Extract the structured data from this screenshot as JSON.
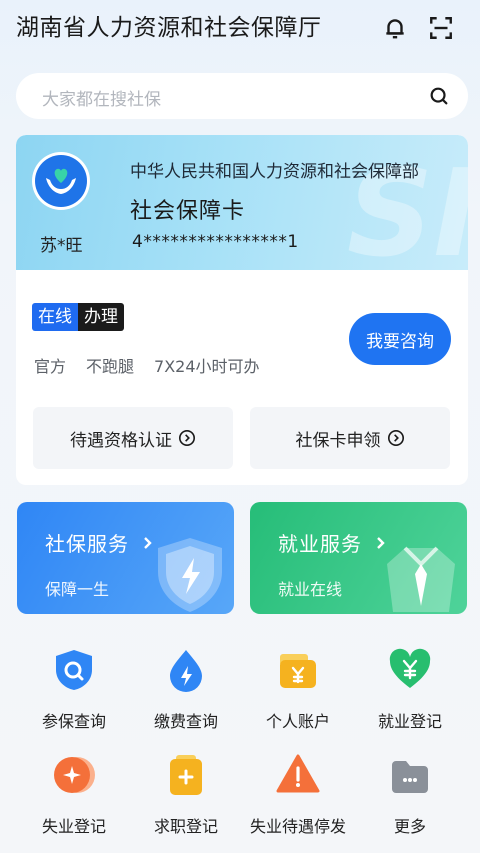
{
  "header": {
    "title": "湖南省人力资源和社会保障厅",
    "bell_icon": "bell-icon",
    "scan_icon": "scan-icon"
  },
  "search": {
    "placeholder": "大家都在搜社保",
    "icon": "search-icon"
  },
  "si_card": {
    "issuer": "中华人民共和国人力资源和社会保障部",
    "card_name": "社会保障卡",
    "holder_name": "苏*旺",
    "card_number": "4****************1",
    "watermark": "SI"
  },
  "online": {
    "badge_part1": "在线",
    "badge_part2": "办理",
    "tags": [
      "官方",
      "不跑腿",
      "7X24小时可办"
    ],
    "consult_label": "我要咨询",
    "actions": [
      {
        "label": "待遇资格认证"
      },
      {
        "label": "社保卡申领"
      }
    ]
  },
  "services": [
    {
      "title": "社保服务",
      "subtitle": "保障一生",
      "color": "#2f86f5"
    },
    {
      "title": "就业服务",
      "subtitle": "就业在线",
      "color": "#26bd78"
    }
  ],
  "grid": [
    {
      "label": "参保查询",
      "icon": "insurance-query-icon",
      "color": "#2f86f5"
    },
    {
      "label": "缴费查询",
      "icon": "payment-query-icon",
      "color": "#2f86f5"
    },
    {
      "label": "个人账户",
      "icon": "personal-account-icon",
      "color": "#f5b21f"
    },
    {
      "label": "就业登记",
      "icon": "employment-register-icon",
      "color": "#27be6f"
    },
    {
      "label": "失业登记",
      "icon": "unemployment-register-icon",
      "color": "#f4703a"
    },
    {
      "label": "求职登记",
      "icon": "job-seek-register-icon",
      "color": "#f5b21f"
    },
    {
      "label": "失业待遇停发",
      "icon": "benefit-stop-icon",
      "color": "#f4703a"
    },
    {
      "label": "更多",
      "icon": "more-icon",
      "color": "#8a9099"
    }
  ]
}
